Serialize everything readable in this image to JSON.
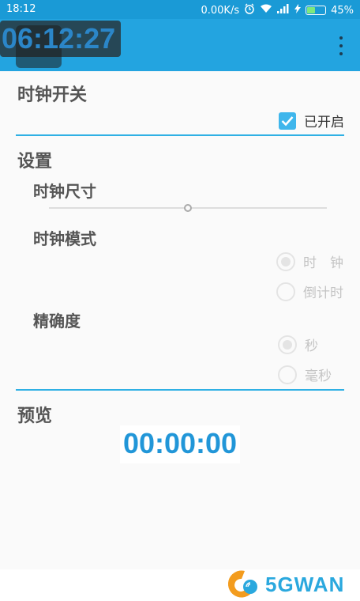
{
  "status_bar": {
    "time": "18:12",
    "speed": "0.00K/s",
    "battery_percent": "45%",
    "battery_level": 0.45,
    "icons": [
      "alarm-icon",
      "wifi-icon",
      "signal-icon",
      "charging-icon",
      "battery-icon"
    ]
  },
  "overlay_clock": {
    "time": "06:12:27"
  },
  "app_bar": {
    "menu_icon": "more-vert-icon"
  },
  "switch_section": {
    "title": "时钟开关",
    "checkbox_label": "已开启",
    "checked": true
  },
  "settings_section": {
    "title": "设置",
    "clock_size": {
      "title": "时钟尺寸",
      "slider_value": 0.5
    },
    "clock_mode": {
      "title": "时钟模式",
      "options": [
        {
          "label": "时　钟",
          "selected": true
        },
        {
          "label": "倒计时",
          "selected": false
        }
      ]
    },
    "precision": {
      "title": "精确度",
      "options": [
        {
          "label": "秒",
          "selected": true
        },
        {
          "label": "毫秒",
          "selected": false
        }
      ]
    }
  },
  "preview_section": {
    "title": "预览",
    "time": "00:00:00"
  },
  "watermark": {
    "brand": "5GWAN"
  },
  "colors": {
    "status_bar": "#1a9ad6",
    "app_bar": "#23a4e0",
    "accent": "#2fb0e4",
    "clock_text": "#2196d8"
  }
}
